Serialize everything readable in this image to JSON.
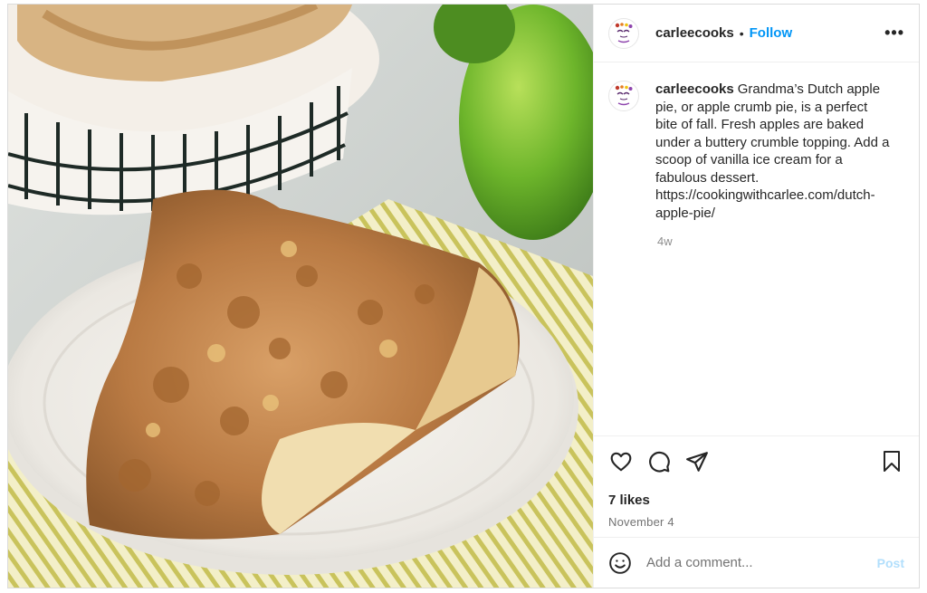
{
  "post": {
    "username": "carleecooks",
    "follow_label": "Follow",
    "more_icon": "more-options-icon",
    "avatar_icon": "profile-logo-icon",
    "photo_alt": "Slice of Dutch apple pie on a white plate"
  },
  "caption": {
    "username": "carleecooks",
    "text": "Grandma’s Dutch apple pie, or apple crumb pie, is a perfect bite of fall. Fresh apples are baked under a buttery crumble topping. Add a scoop of vanilla ice cream for a fabulous dessert. https://cookingwithcarlee.com/dutch-apple-pie/",
    "time": "4w"
  },
  "actions": {
    "like_icon": "heart-icon",
    "comment_icon": "comment-icon",
    "share_icon": "share-icon",
    "save_icon": "bookmark-icon",
    "likes": "7 likes",
    "date": "November 4"
  },
  "comment": {
    "emoji_icon": "emoji-icon",
    "placeholder": "Add a comment...",
    "post_label": "Post"
  },
  "colors": {
    "accent": "#0095f6",
    "post_disabled": "#b2dffc",
    "text": "#262626",
    "muted": "#8e8e8e"
  }
}
